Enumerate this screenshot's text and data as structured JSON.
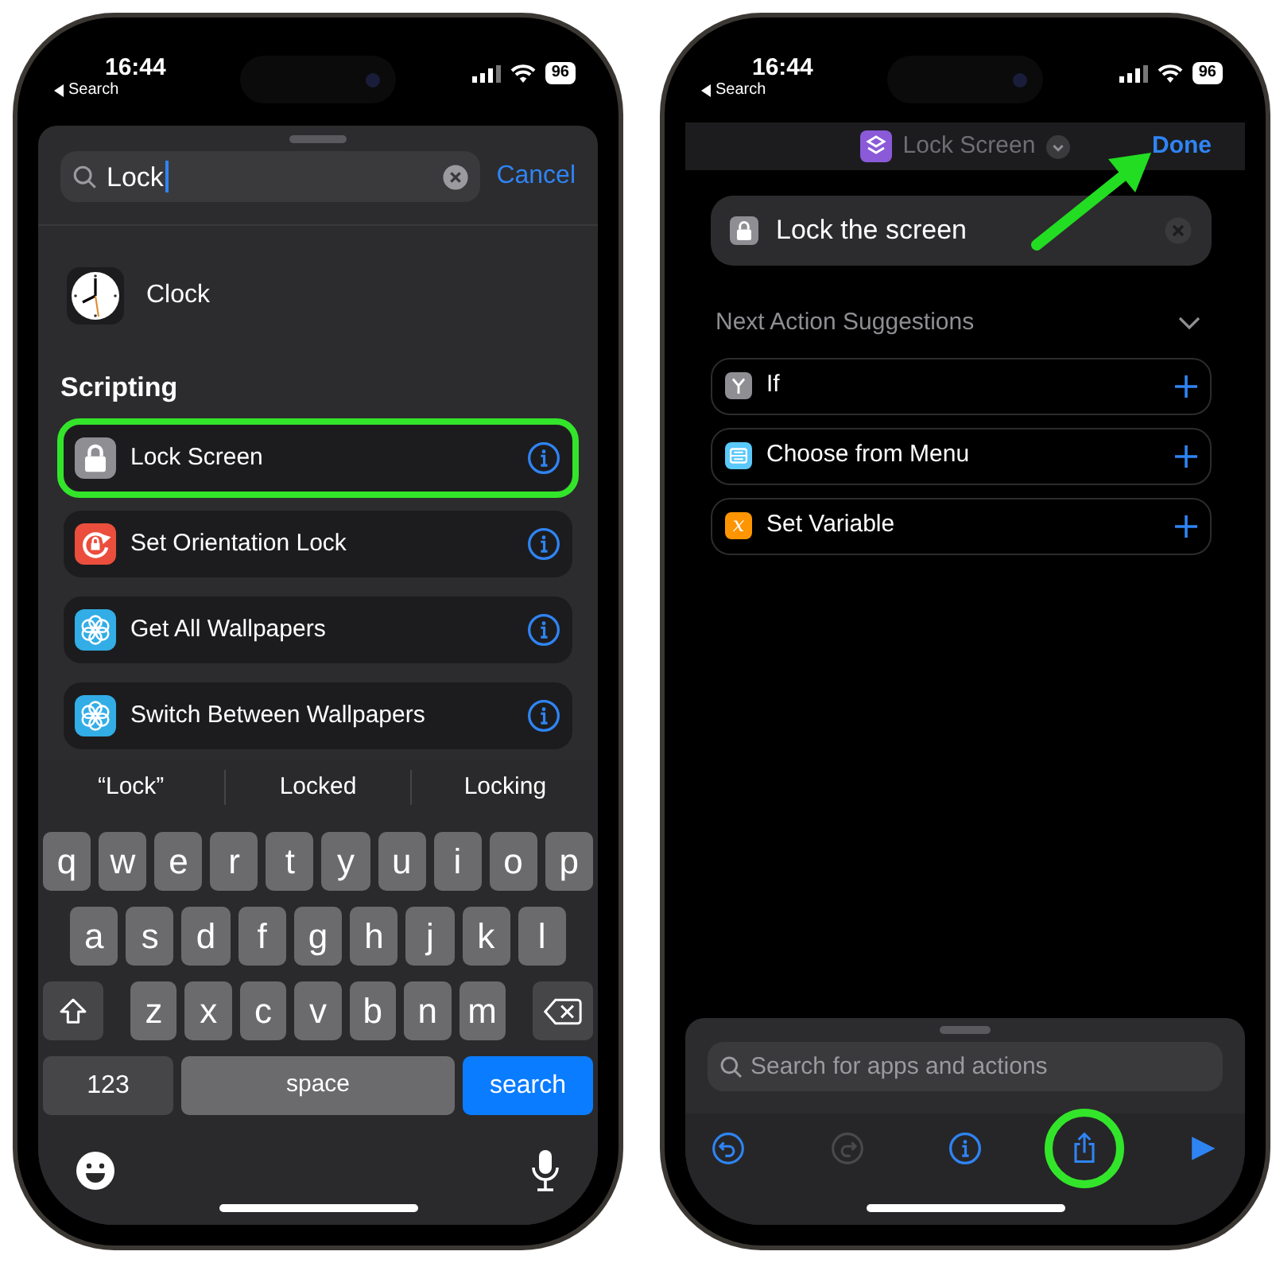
{
  "left_screen": {
    "status_bar": {
      "time": "16:44",
      "back_label": "Search",
      "battery": "96"
    },
    "search_field": {
      "value": "Lock"
    },
    "cancel_button": "Cancel",
    "apps": [
      {
        "name": "Clock"
      }
    ],
    "section_title": "Scripting",
    "actions": [
      {
        "name": "Lock Screen",
        "kind": "lock",
        "color": "#8e8e93",
        "highlighted": true
      },
      {
        "name": "Set Orientation Lock",
        "kind": "orientation",
        "color": "#eb4e3d",
        "highlighted": false
      },
      {
        "name": "Get All Wallpapers",
        "kind": "flower",
        "color": "#32ade6",
        "highlighted": false
      },
      {
        "name": "Switch Between Wallpapers",
        "kind": "flower",
        "color": "#32ade6",
        "highlighted": false
      }
    ],
    "keyboard": {
      "suggestions": [
        "“Lock”",
        "Locked",
        "Locking"
      ],
      "letter_rows": [
        [
          "q",
          "w",
          "e",
          "r",
          "t",
          "y",
          "u",
          "i",
          "o",
          "p"
        ],
        [
          "a",
          "s",
          "d",
          "f",
          "g",
          "h",
          "j",
          "k",
          "l"
        ],
        [
          "z",
          "x",
          "c",
          "v",
          "b",
          "n",
          "m"
        ]
      ],
      "numbers_key": "123",
      "space_key": "space",
      "return_key": "search"
    }
  },
  "right_screen": {
    "status_bar": {
      "time": "16:44",
      "back_label": "Search",
      "battery": "96"
    },
    "nav": {
      "title": "Lock Screen",
      "done": "Done",
      "arrow_pointer": true
    },
    "action": {
      "title": "Lock the screen"
    },
    "suggestions_title": "Next Action Suggestions",
    "suggestions": [
      {
        "name": "If",
        "kind": "branch",
        "color": "#8e8e93"
      },
      {
        "name": "Choose from Menu",
        "kind": "menu",
        "color": "#5ac8fa"
      },
      {
        "name": "Set Variable",
        "kind": "glyph",
        "glyph": "x",
        "color": "#ff9500"
      }
    ],
    "search_field": {
      "placeholder": "Search for apps and actions"
    },
    "toolbar": [
      {
        "kind": "undo",
        "disabled": false,
        "highlighted": false
      },
      {
        "kind": "redo",
        "disabled": true,
        "highlighted": false
      },
      {
        "kind": "info",
        "disabled": false,
        "highlighted": false
      },
      {
        "kind": "share",
        "disabled": false,
        "highlighted": true
      },
      {
        "kind": "play",
        "disabled": false,
        "highlighted": false
      }
    ]
  }
}
